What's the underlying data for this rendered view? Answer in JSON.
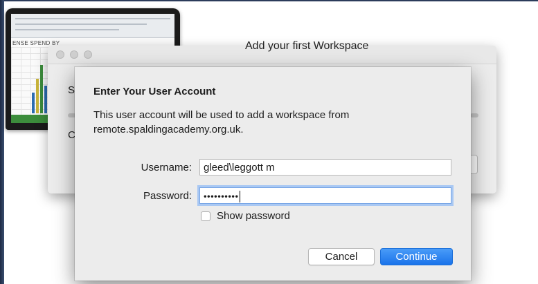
{
  "background": {
    "laptop_sheet_title": "ENSE SPEND BY",
    "window_heading": "Add your first Workspace",
    "left_letters": [
      "S",
      "C"
    ]
  },
  "dialog": {
    "heading": "Enter Your User Account",
    "description": "This user account will be used to add a workspace from remote.spaldingacademy.org.uk.",
    "username_label": "Username:",
    "username_value": "gleed\\leggott m",
    "password_label": "Password:",
    "password_masked": "••••••••••",
    "show_password_label": "Show password",
    "show_password_checked": false,
    "cancel_label": "Cancel",
    "continue_label": "Continue"
  },
  "colors": {
    "accent": "#1a73ea",
    "focus_ring": "#a9c8f3",
    "dialog_bg": "#ececec"
  }
}
